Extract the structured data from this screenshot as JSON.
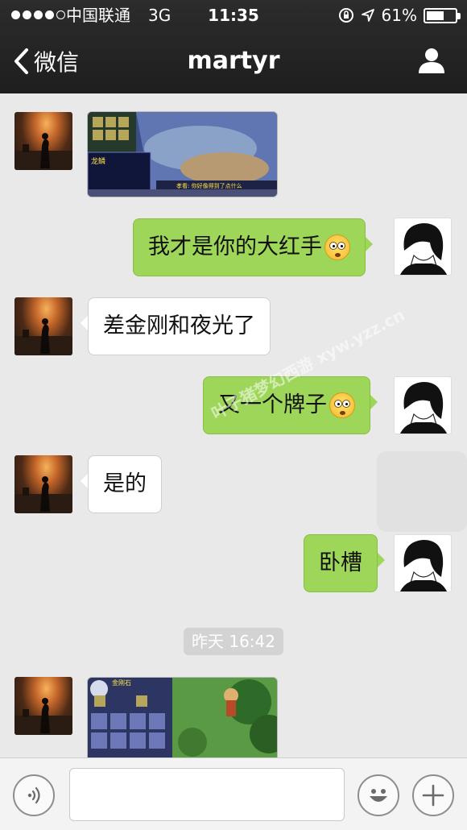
{
  "status": {
    "carrier": "中国联通",
    "network": "3G",
    "time": "11:35",
    "battery": "61%",
    "battery_level": 0.61
  },
  "nav": {
    "back_label": "微信",
    "title": "martyr"
  },
  "messages": [
    {
      "side": "left",
      "kind": "image"
    },
    {
      "side": "right",
      "kind": "text",
      "text": "我才是你的大红手",
      "emoji": "flushed-face"
    },
    {
      "side": "left",
      "kind": "text",
      "text": "差金刚和夜光了"
    },
    {
      "side": "right",
      "kind": "text",
      "text": "又一个牌子",
      "emoji": "flushed-face"
    },
    {
      "side": "left",
      "kind": "text",
      "text": "是的"
    },
    {
      "side": "right",
      "kind": "text",
      "text": "卧槽"
    },
    {
      "side": "left",
      "kind": "image"
    }
  ],
  "timestamp": "昨天 16:42",
  "image1_caption": "龙鳞",
  "image1_dialog": "孝看: 你好像得到了点什么",
  "image2_caption": "金刚石",
  "watermark": "叶子猪梦幻西游 xyw.yzz.cn",
  "input": {
    "placeholder": "",
    "value": ""
  },
  "colors": {
    "nav_bg": "#1f1f1f",
    "chat_bg": "#e9e9e9",
    "self_bubble": "#9ed65a",
    "other_bubble": "#ffffff"
  }
}
